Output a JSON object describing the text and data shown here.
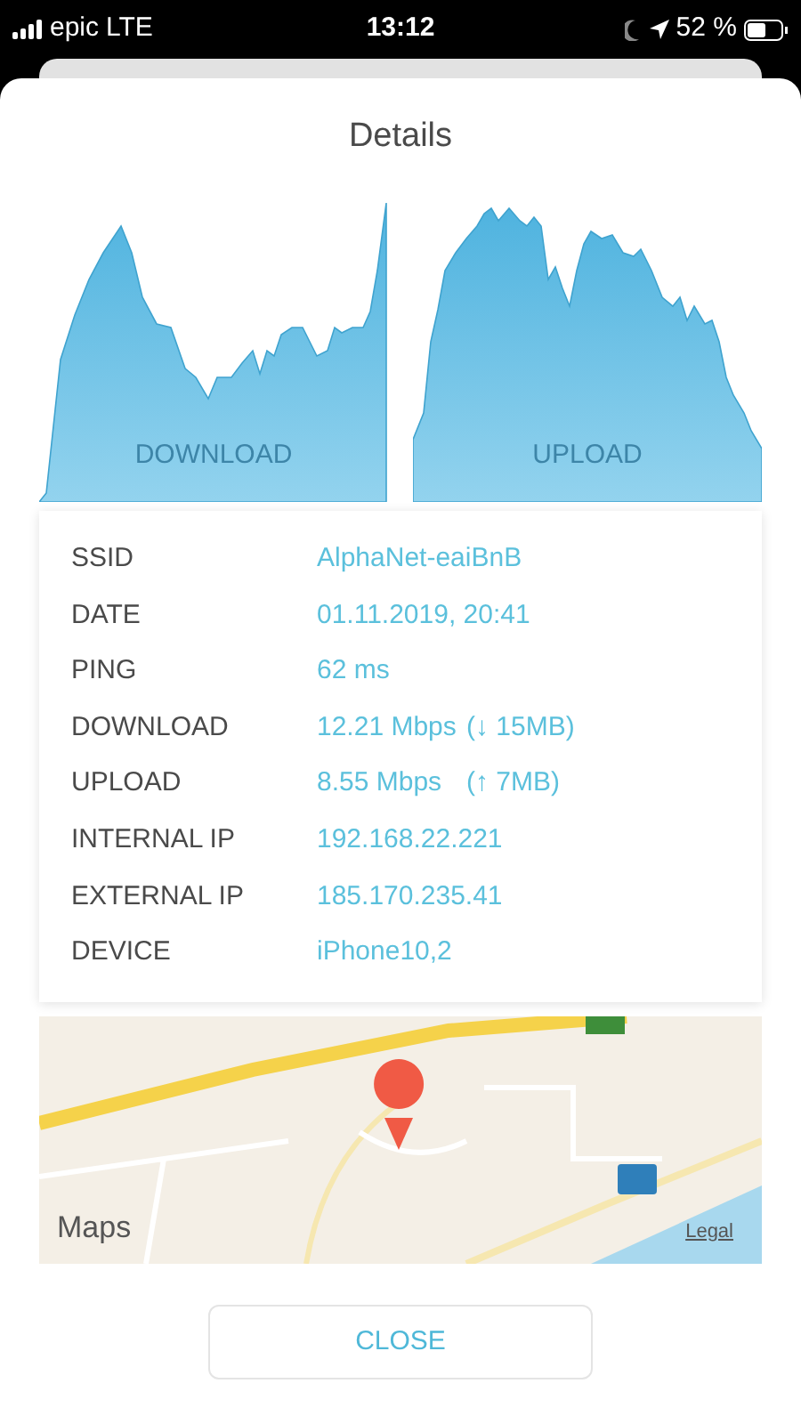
{
  "status_bar": {
    "carrier": "epic",
    "network": "LTE",
    "time": "13:12",
    "battery": "52 %"
  },
  "title": "Details",
  "graphs": [
    {
      "kind": "download",
      "label": "DOWNLOAD"
    },
    {
      "kind": "upload",
      "label": "UPLOAD"
    }
  ],
  "info": [
    {
      "label": "SSID",
      "value": "AlphaNet-eaiBnB"
    },
    {
      "label": "DATE",
      "value": "01.11.2019, 20:41"
    },
    {
      "label": "PING",
      "value": "62 ms"
    },
    {
      "label": "DOWNLOAD",
      "value": "12.21 Mbps",
      "detail": "(↓ 15MB)"
    },
    {
      "label": "UPLOAD",
      "value": "8.55 Mbps",
      "detail": "(↑ 7MB)"
    },
    {
      "label": "INTERNAL IP",
      "value": "192.168.22.221"
    },
    {
      "label": "EXTERNAL IP",
      "value": "185.170.235.41"
    },
    {
      "label": "DEVICE",
      "value": "iPhone10,2"
    }
  ],
  "map": {
    "logo": "Maps",
    "legal": "Legal"
  },
  "close_button": "CLOSE"
}
